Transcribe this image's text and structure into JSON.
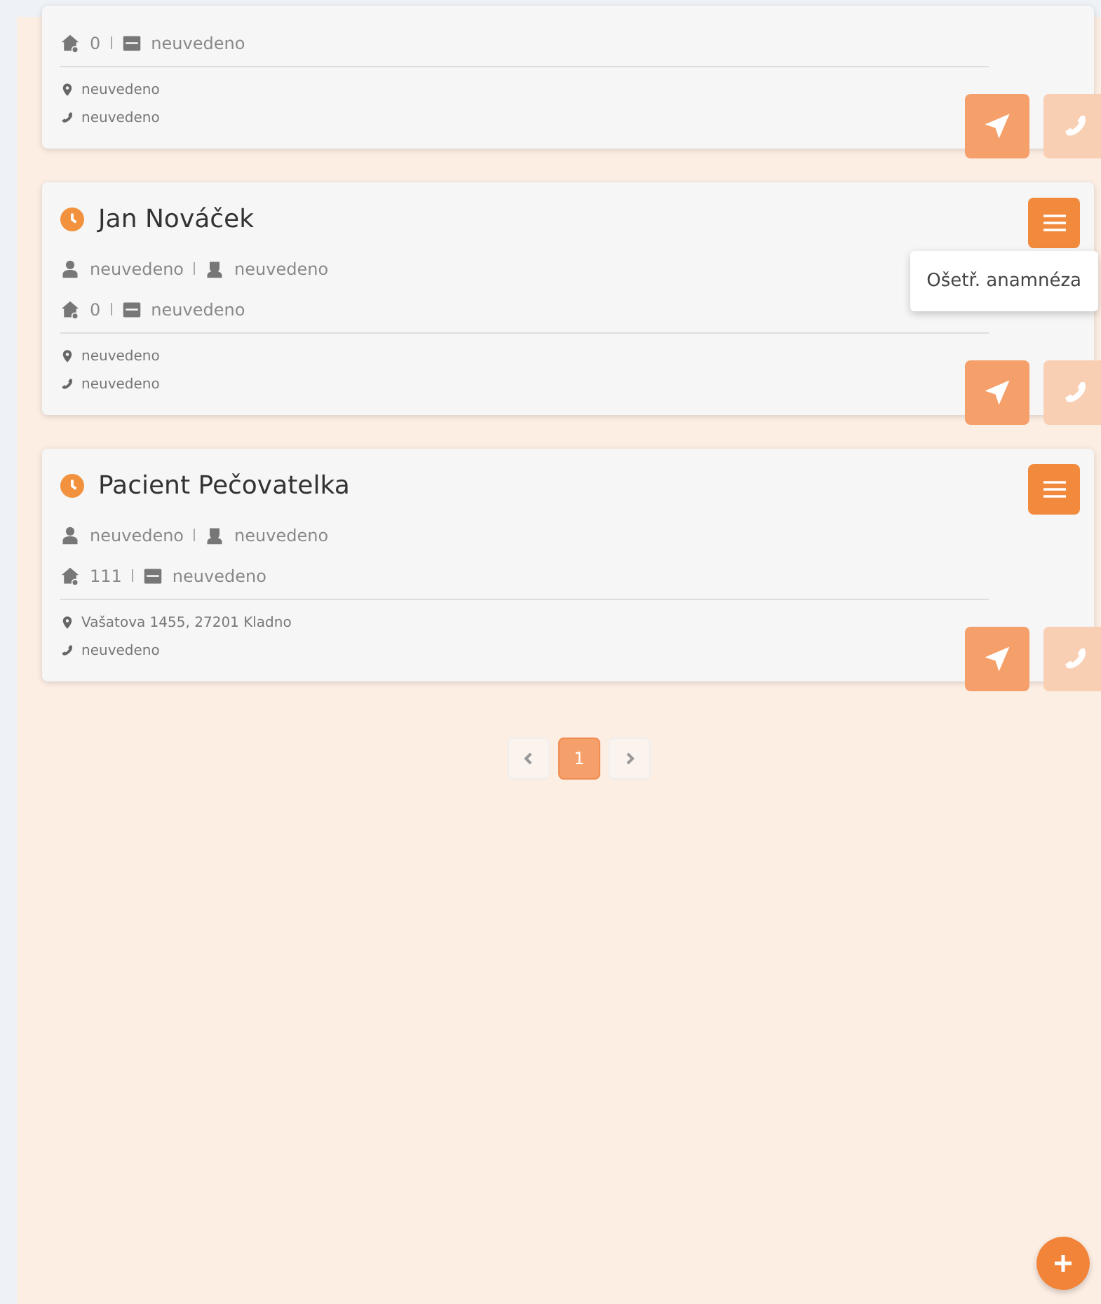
{
  "cards": [
    {
      "room": "0",
      "bed": "neuvedeno",
      "address": "neuvedeno",
      "phone": "neuvedeno",
      "menu_open": false,
      "nav_disabled": false,
      "call_disabled": true
    },
    {
      "name": "Jan Nováček",
      "persons": [
        "neuvedeno",
        "neuvedeno"
      ],
      "room": "0",
      "bed": "neuvedeno",
      "address": "neuvedeno",
      "phone": "neuvedeno",
      "menu_open": true,
      "menu_items": [
        "Ošetř. anamnéza"
      ],
      "nav_disabled": false,
      "call_disabled": true
    },
    {
      "name": "Pacient Pečovatelka",
      "persons": [
        "neuvedeno",
        "neuvedeno"
      ],
      "room": "111",
      "bed": "neuvedeno",
      "address": "Vašatova 1455, 27201 Kladno",
      "phone": "neuvedeno",
      "menu_open": false,
      "nav_disabled": false,
      "call_disabled": true
    }
  ],
  "pagination": {
    "pages": [
      {
        "label": "1",
        "selected": true
      }
    ]
  }
}
